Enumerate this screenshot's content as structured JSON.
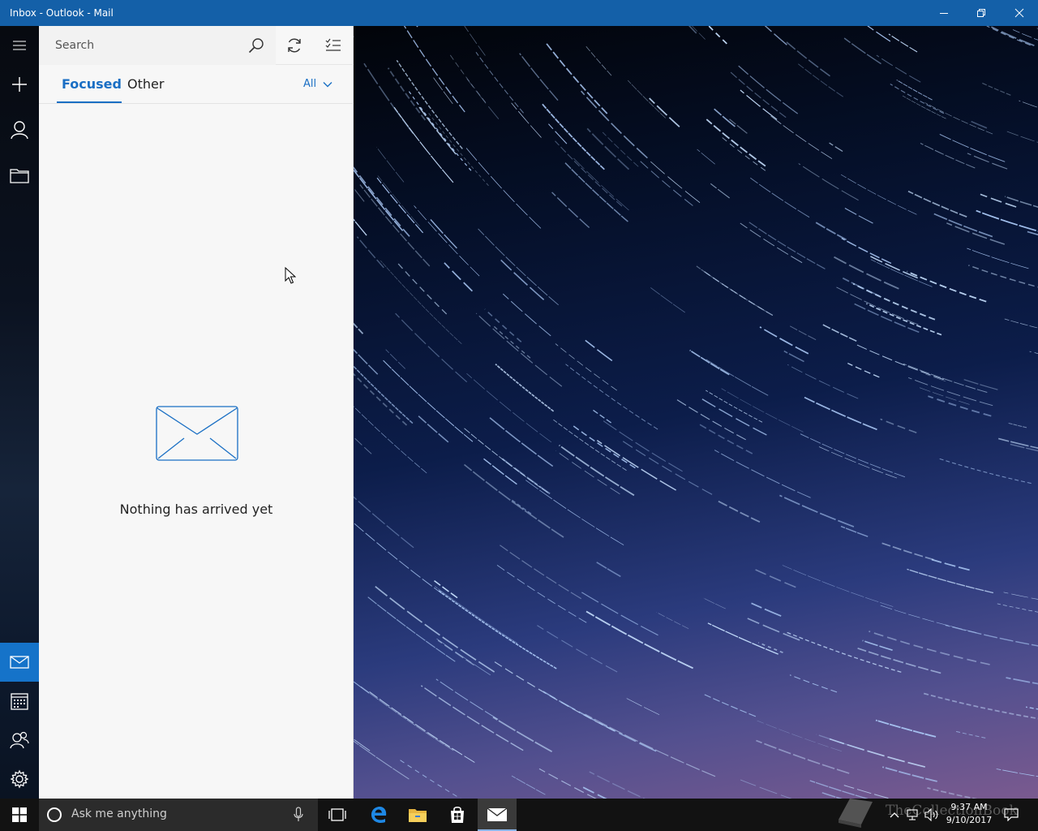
{
  "window": {
    "title": "Inbox - Outlook - Mail",
    "controls": [
      "minimize-icon",
      "restore-icon",
      "close-icon"
    ],
    "titlebar_color": "#1460a8"
  },
  "nav_rail": {
    "top_items": [
      "hamburger-menu-icon",
      "new-mail-icon",
      "accounts-icon",
      "folders-icon"
    ],
    "bottom_items": [
      "mail-icon",
      "calendar-icon",
      "people-icon",
      "settings-icon"
    ],
    "active_item": "mail-icon",
    "accent_color": "#1573c9"
  },
  "search": {
    "placeholder": "Search"
  },
  "toolbar": {
    "icons": [
      "search-icon",
      "sync-icon",
      "selection-mode-icon"
    ]
  },
  "tabs": {
    "focused": "Focused",
    "other": "Other",
    "active": "Focused",
    "filter_label": "All"
  },
  "empty_state": {
    "icon": "envelope-icon",
    "message": "Nothing has arrived yet"
  },
  "taskbar": {
    "search_placeholder": "Ask me anything",
    "pinned_apps": [
      "task-view-icon",
      "edge-icon",
      "file-explorer-icon",
      "store-icon",
      "mail-app-icon"
    ],
    "active_app": "mail-app-icon",
    "time": "9:37 AM",
    "date": "9/10/2017",
    "watermark": "TheCollectionBook"
  }
}
